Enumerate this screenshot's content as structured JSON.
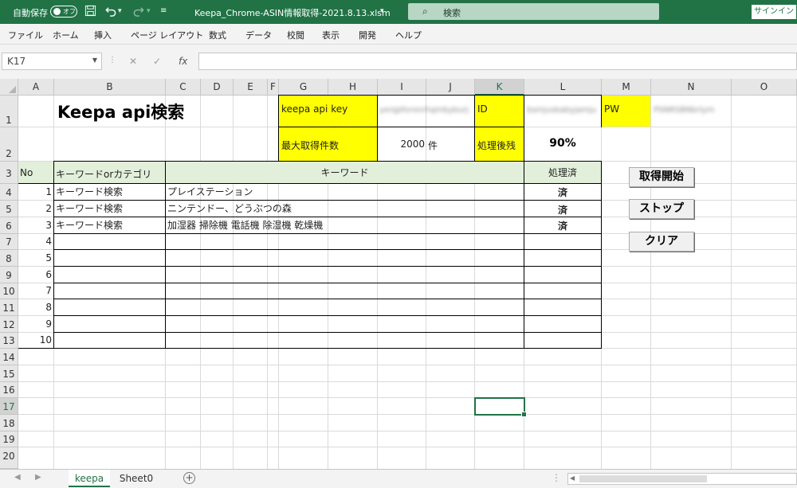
{
  "titlebar": {
    "autosave_label": "自動保存",
    "toggle_state": "オフ",
    "filename": "Keepa_Chrome-ASIN情報取得-2021.8.13.xlsm",
    "search_placeholder": "検索",
    "signin_label": "サインイン",
    "icons": [
      "save-icon",
      "undo-icon",
      "redo-icon",
      "customize-qat-icon"
    ]
  },
  "menu": [
    "ファイル",
    "ホーム",
    "挿入",
    "ページ レイアウト",
    "数式",
    "データ",
    "校閲",
    "表示",
    "開発",
    "ヘルプ"
  ],
  "formula_bar": {
    "name_box": "K17",
    "formula": ""
  },
  "columns": [
    "A",
    "B",
    "C",
    "D",
    "E",
    "F",
    "G",
    "H",
    "I",
    "J",
    "K",
    "L",
    "M",
    "N",
    "O"
  ],
  "selected_column": "K",
  "rows": [
    "1",
    "2",
    "3",
    "4",
    "5",
    "6",
    "7",
    "8",
    "9",
    "10",
    "11",
    "12",
    "13",
    "14",
    "15",
    "16",
    "17",
    "18",
    "19",
    "20"
  ],
  "selected_row": "17",
  "cells": {
    "title": "Keepa api検索",
    "api_key_label": "keepa api key",
    "api_key_value": "yenjpforonrhqmbyburj",
    "id_label": "ID",
    "id_value": "bsmjuskabyjamju",
    "pw_label": "PW",
    "pw_value": "PSNRSBNbrlym",
    "max_label": "最大取得件数",
    "max_value": "2000",
    "max_unit": "件",
    "remaining_label": "処理後残",
    "remaining_value": "90%"
  },
  "table": {
    "headers": {
      "no": "No",
      "type": "キーワードorカテゴリ",
      "keyword": "キーワード",
      "done": "処理済"
    },
    "rows": [
      {
        "no": "1",
        "type": "キーワード検索",
        "keyword": "プレイステーション",
        "done": "済"
      },
      {
        "no": "2",
        "type": "キーワード検索",
        "keyword": "ニンテンドー、どうぶつの森",
        "done": "済"
      },
      {
        "no": "3",
        "type": "キーワード検索",
        "keyword": "加湿器 掃除機 電話機 除湿機 乾燥機",
        "done": "済"
      },
      {
        "no": "4",
        "type": "",
        "keyword": "",
        "done": ""
      },
      {
        "no": "5",
        "type": "",
        "keyword": "",
        "done": ""
      },
      {
        "no": "6",
        "type": "",
        "keyword": "",
        "done": ""
      },
      {
        "no": "7",
        "type": "",
        "keyword": "",
        "done": ""
      },
      {
        "no": "8",
        "type": "",
        "keyword": "",
        "done": ""
      },
      {
        "no": "9",
        "type": "",
        "keyword": "",
        "done": ""
      },
      {
        "no": "10",
        "type": "",
        "keyword": "",
        "done": ""
      }
    ]
  },
  "buttons": {
    "start": "取得開始",
    "stop": "ストップ",
    "clear": "クリア"
  },
  "sheets": [
    {
      "name": "keepa",
      "active": true
    },
    {
      "name": "Sheet0",
      "active": false
    }
  ],
  "colors": {
    "excel_green": "#217346",
    "label_yellow": "#ffff00",
    "header_green": "#e2efda"
  }
}
